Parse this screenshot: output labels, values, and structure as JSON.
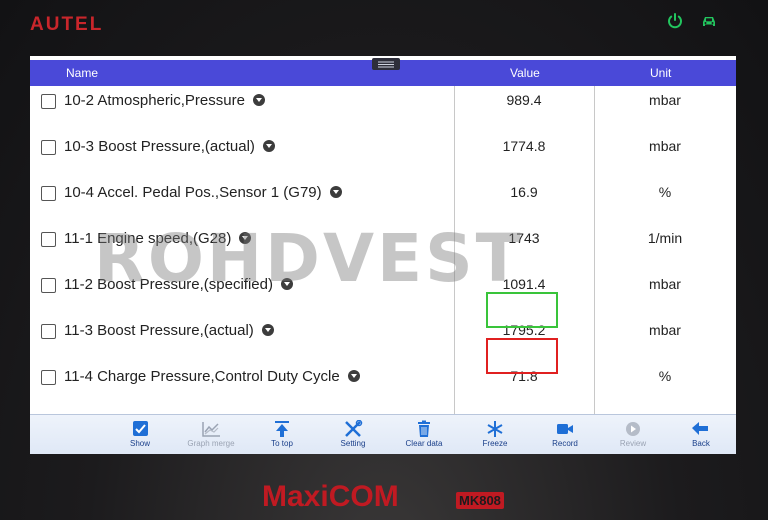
{
  "device": {
    "brand": "AUTEL",
    "model": "MaxiCOM",
    "model_badge": "MK808",
    "status_icons": [
      "power-icon",
      "car-icon"
    ],
    "status_color": "#22c55e",
    "brand_color": "#c9262b"
  },
  "table": {
    "headers": {
      "name": "Name",
      "value": "Value",
      "unit": "Unit"
    },
    "header_color": "#4a49d8",
    "rows": [
      {
        "name": "10-2 Atmospheric,Pressure",
        "value": "989.4",
        "unit": "mbar",
        "checked": false
      },
      {
        "name": "10-3 Boost Pressure,(actual)",
        "value": "1774.8",
        "unit": "mbar",
        "checked": false
      },
      {
        "name": "10-4 Accel. Pedal Pos.,Sensor 1 (G79)",
        "value": "16.9",
        "unit": "%",
        "checked": false
      },
      {
        "name": "11-1 Engine speed,(G28)",
        "value": "1743",
        "unit": "1/min",
        "checked": false
      },
      {
        "name": "11-2 Boost Pressure,(specified)",
        "value": "1091.4",
        "unit": "mbar",
        "checked": false,
        "highlight": "#39c43a"
      },
      {
        "name": "11-3 Boost Pressure,(actual)",
        "value": "1795.2",
        "unit": "mbar",
        "checked": false,
        "highlight": "#e02020"
      },
      {
        "name": "11-4 Charge Pressure,Control Duty Cycle",
        "value": "71.8",
        "unit": "%",
        "checked": false
      }
    ]
  },
  "toolbar": {
    "buttons": [
      {
        "label": "Show",
        "icon": "checkbox-icon",
        "enabled": true
      },
      {
        "label": "Graph merge",
        "icon": "graph-merge-icon",
        "enabled": false
      },
      {
        "label": "To top",
        "icon": "to-top-icon",
        "enabled": true
      },
      {
        "label": "Setting",
        "icon": "wrench-screwdriver-icon",
        "enabled": true
      },
      {
        "label": "Clear data",
        "icon": "trash-icon",
        "enabled": true
      },
      {
        "label": "Freeze",
        "icon": "snowflake-icon",
        "enabled": true
      },
      {
        "label": "Record",
        "icon": "video-camera-icon",
        "enabled": true
      },
      {
        "label": "Review",
        "icon": "play-icon",
        "enabled": false
      },
      {
        "label": "Back",
        "icon": "back-arrow-icon",
        "enabled": true
      }
    ],
    "icon_color": "#1f6fd6"
  },
  "overlay": {
    "watermark": "ROHDVEST"
  }
}
